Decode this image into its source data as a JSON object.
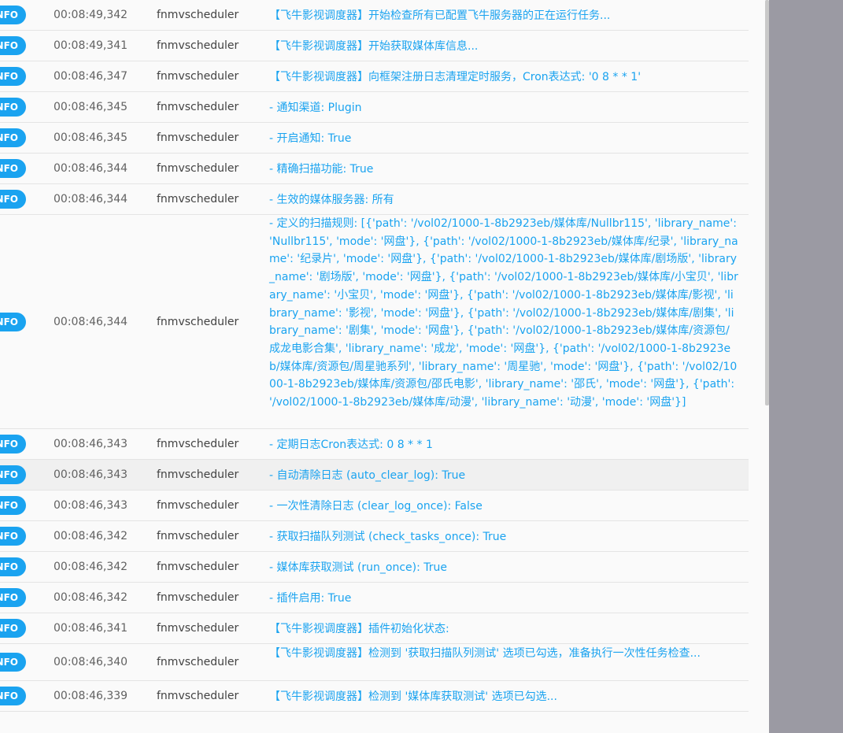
{
  "log": {
    "rows": [
      {
        "level": "INFO",
        "time": "00:08:49,342",
        "source": "fnmvscheduler",
        "message": "【飞牛影视调度器】开始检查所有已配置飞牛服务器的正在运行任务..."
      },
      {
        "level": "INFO",
        "time": "00:08:49,341",
        "source": "fnmvscheduler",
        "message": "【飞牛影视调度器】开始获取媒体库信息..."
      },
      {
        "level": "INFO",
        "time": "00:08:46,347",
        "source": "fnmvscheduler",
        "message": "【飞牛影视调度器】向框架注册日志清理定时服务，Cron表达式: '0 8 * * 1'"
      },
      {
        "level": "INFO",
        "time": "00:08:46,345",
        "source": "fnmvscheduler",
        "message": "- 通知渠道: Plugin"
      },
      {
        "level": "INFO",
        "time": "00:08:46,345",
        "source": "fnmvscheduler",
        "message": "- 开启通知: True"
      },
      {
        "level": "INFO",
        "time": "00:08:46,344",
        "source": "fnmvscheduler",
        "message": "- 精确扫描功能: True"
      },
      {
        "level": "INFO",
        "time": "00:08:46,344",
        "source": "fnmvscheduler",
        "message": "- 生效的媒体服务器: 所有"
      },
      {
        "level": "INFO",
        "time": "00:08:46,344",
        "source": "fnmvscheduler",
        "message": "- 定义的扫描规则: [{'path': '/vol02/1000-1-8b2923eb/媒体库/Nullbr115', 'library_name': 'Nullbr115', 'mode': '网盘'}, {'path': '/vol02/1000-1-8b2923eb/媒体库/纪录', 'library_name': '纪录片', 'mode': '网盘'}, {'path': '/vol02/1000-1-8b2923eb/媒体库/剧场版', 'library_name': '剧场版', 'mode': '网盘'}, {'path': '/vol02/1000-1-8b2923eb/媒体库/小宝贝', 'library_name': '小宝贝', 'mode': '网盘'}, {'path': '/vol02/1000-1-8b2923eb/媒体库/影视', 'library_name': '影视', 'mode': '网盘'}, {'path': '/vol02/1000-1-8b2923eb/媒体库/剧集', 'library_name': '剧集', 'mode': '网盘'}, {'path': '/vol02/1000-1-8b2923eb/媒体库/资源包/成龙电影合集', 'library_name': '成龙', 'mode': '网盘'}, {'path': '/vol02/1000-1-8b2923eb/媒体库/资源包/周星驰系列', 'library_name': '周星驰', 'mode': '网盘'}, {'path': '/vol02/1000-1-8b2923eb/媒体库/资源包/邵氏电影', 'library_name': '邵氏', 'mode': '网盘'}, {'path': '/vol02/1000-1-8b2923eb/媒体库/动漫', 'library_name': '动漫', 'mode': '网盘'}]"
      },
      {
        "level": "INFO",
        "time": "00:08:46,343",
        "source": "fnmvscheduler",
        "message": "- 定期日志Cron表达式: 0 8 * * 1"
      },
      {
        "level": "INFO",
        "time": "00:08:46,343",
        "source": "fnmvscheduler",
        "message": "- 自动清除日志 (auto_clear_log): True"
      },
      {
        "level": "INFO",
        "time": "00:08:46,343",
        "source": "fnmvscheduler",
        "message": "- 一次性清除日志 (clear_log_once): False"
      },
      {
        "level": "INFO",
        "time": "00:08:46,342",
        "source": "fnmvscheduler",
        "message": "- 获取扫描队列测试 (check_tasks_once): True"
      },
      {
        "level": "INFO",
        "time": "00:08:46,342",
        "source": "fnmvscheduler",
        "message": "- 媒体库获取测试 (run_once): True"
      },
      {
        "level": "INFO",
        "time": "00:08:46,342",
        "source": "fnmvscheduler",
        "message": "- 插件启用: True"
      },
      {
        "level": "INFO",
        "time": "00:08:46,341",
        "source": "fnmvscheduler",
        "message": "【飞牛影视调度器】插件初始化状态:"
      },
      {
        "level": "INFO",
        "time": "00:08:46,340",
        "source": "fnmvscheduler",
        "message": "【飞牛影视调度器】检测到 '获取扫描队列测试' 选项已勾选，准备执行一次性任务检查..."
      },
      {
        "level": "INFO",
        "time": "00:08:46,339",
        "source": "fnmvscheduler",
        "message": "【飞牛影视调度器】检测到 '媒体库获取测试' 选项已勾选..."
      }
    ]
  },
  "colors": {
    "badge": "#1aa3f0",
    "message": "#1aa3f0",
    "backdrop": "#9b9aa3"
  }
}
